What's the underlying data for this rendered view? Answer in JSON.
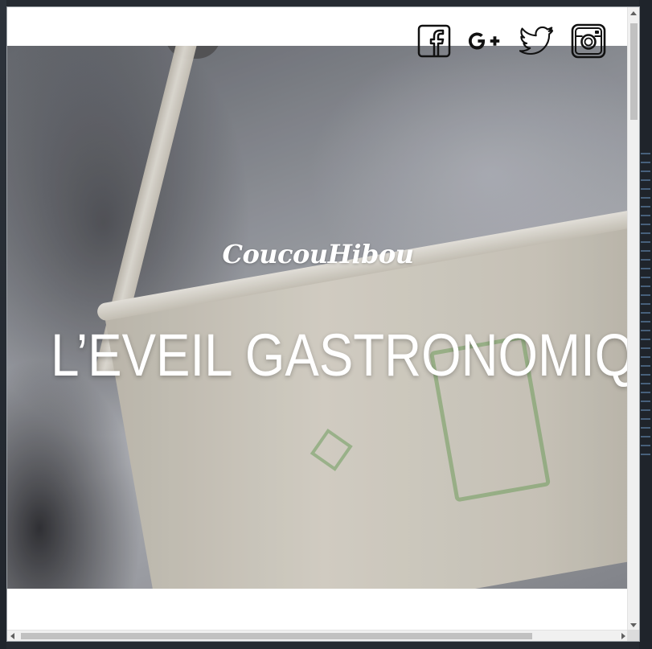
{
  "page": {
    "brand": "CoucouHibou",
    "headline": "L’EVEIL GASTRONOMIQUE"
  },
  "social": [
    {
      "name": "facebook-icon",
      "label": "f"
    },
    {
      "name": "google-plus-icon",
      "label": "G+"
    },
    {
      "name": "twitter-icon",
      "label": ""
    },
    {
      "name": "instagram-icon",
      "label": ""
    }
  ],
  "colors": {
    "page_background": "#ffffff",
    "hero_text": "#ffffff",
    "icon_color": "#111111"
  }
}
